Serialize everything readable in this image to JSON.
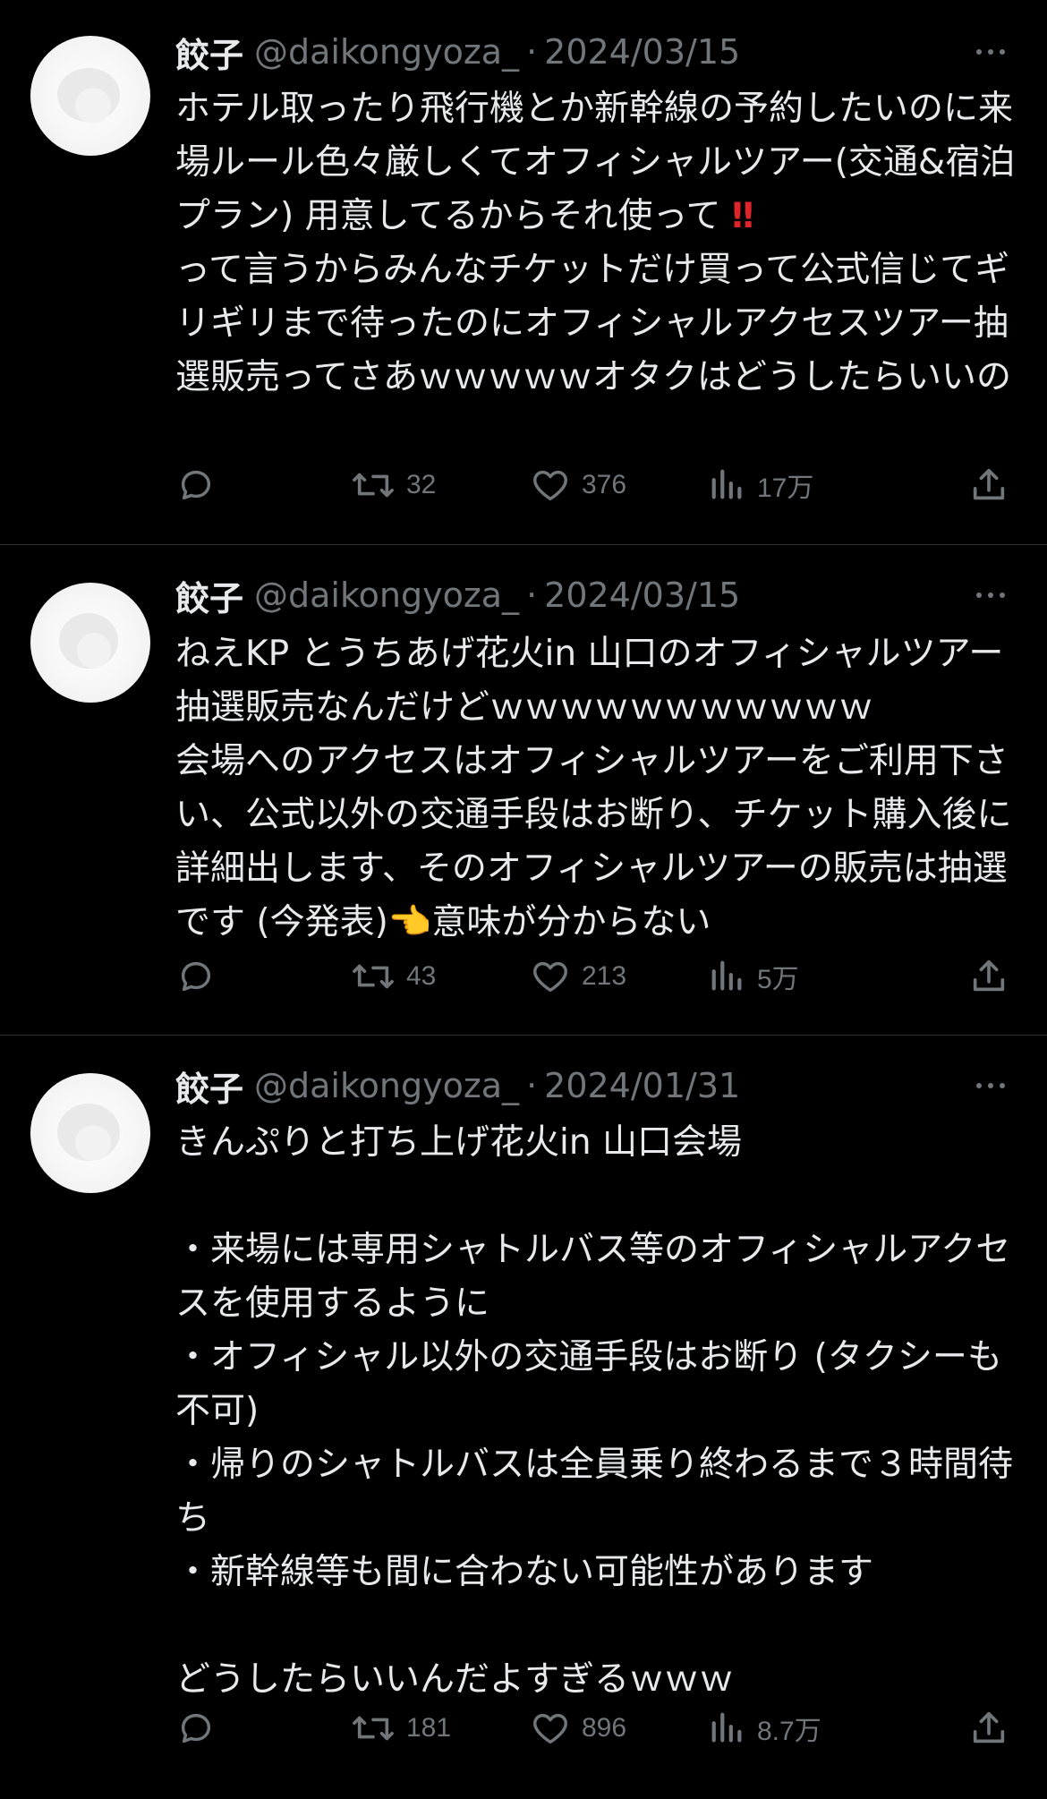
{
  "tweets": [
    {
      "author_name": "餃子",
      "handle": "@daikongyoza_",
      "separator": "·",
      "date": "2024/03/15",
      "text_before": "ホテル取ったり飛行機とか新幹線の予約したいのに来場ルール色々厳しくてオフィシャルツアー(交通&宿泊プラン) 用意してるからそれ使って ",
      "emoji": "‼",
      "text_after": "\nって言うからみんなチケットだけ買って公式信じてギリギリまで待ったのにオフィシャルアクセスツアー抽選販売ってさあｗｗｗｗｗオタクはどうしたらいいの",
      "retweets": "32",
      "likes": "376",
      "views": "17万"
    },
    {
      "author_name": "餃子",
      "handle": "@daikongyoza_",
      "separator": "·",
      "date": "2024/03/15",
      "text_before": "ねえKP とうちあげ花火in 山口のオフィシャルツアー抽選販売なんだけどｗｗｗｗｗｗｗｗｗｗｗ\n会場へのアクセスはオフィシャルツアーをご利用下さい、公式以外の交通手段はお断り、チケット購入後に詳細出します、そのオフィシャルツアーの販売は抽選です (今発表)",
      "emoji": "👈",
      "text_after": "意味が分からない",
      "retweets": "43",
      "likes": "213",
      "views": "5万"
    },
    {
      "author_name": "餃子",
      "handle": "@daikongyoza_",
      "separator": "·",
      "date": "2024/01/31",
      "text_before": "きんぷりと打ち上げ花火in 山口会場\n\n・来場には専用シャトルバス等のオフィシャルアクセスを使用するように\n・オフィシャル以外の交通手段はお断り (タクシーも不可)\n・帰りのシャトルバスは全員乗り終わるまで３時間待ち\n・新幹線等も間に合わない可能性があります\n\nどうしたらいいんだよすぎるｗｗｗ",
      "emoji": "",
      "text_after": "",
      "retweets": "181",
      "likes": "896",
      "views": "8.7万"
    }
  ],
  "icons": {
    "reply": "reply-icon",
    "retweet": "retweet-icon",
    "like": "heart-icon",
    "views": "views-chart-icon",
    "share": "share-icon",
    "more": "more-icon"
  },
  "colors": {
    "background": "#000000",
    "text": "#e7e9ea",
    "secondary": "#71767b",
    "divider": "#2f3336",
    "emphasis": "#e0242a"
  }
}
